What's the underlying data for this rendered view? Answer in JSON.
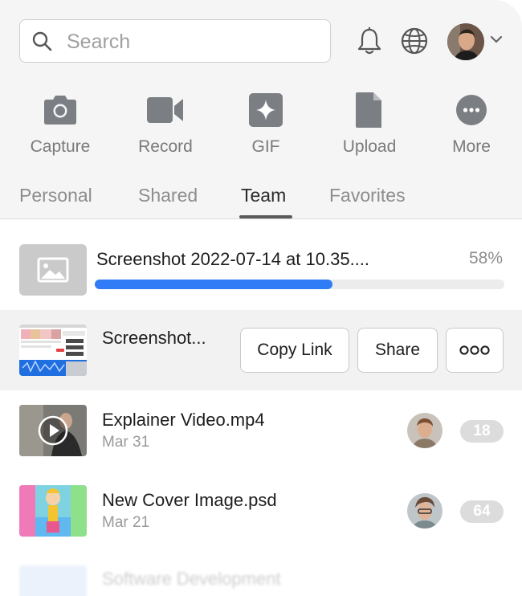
{
  "search": {
    "placeholder": "Search",
    "icon": "search-icon"
  },
  "header_icons": {
    "notifications": "bell-icon",
    "language": "globe-icon",
    "account_menu": "chevron-down-icon"
  },
  "actions": [
    {
      "label": "Capture",
      "icon": "camera-icon"
    },
    {
      "label": "Record",
      "icon": "video-camera-icon"
    },
    {
      "label": "GIF",
      "icon": "sparkle-icon"
    },
    {
      "label": "Upload",
      "icon": "document-icon"
    },
    {
      "label": "More",
      "icon": "more-icon"
    }
  ],
  "tabs": [
    {
      "label": "Personal",
      "active": false
    },
    {
      "label": "Shared",
      "active": false
    },
    {
      "label": "Team",
      "active": true
    },
    {
      "label": "Favorites",
      "active": false
    }
  ],
  "upload": {
    "name": "Screenshot 2022-07-14 at 10.35....",
    "progress_label": "58%",
    "progress": 0.58
  },
  "hovered_item": {
    "name": "Screenshot...",
    "buttons": {
      "copy_link": "Copy Link",
      "share": "Share",
      "more_icon": "more-horizontal-icon"
    }
  },
  "items": [
    {
      "name": "Explainer Video.mp4",
      "date": "Mar 31",
      "count": "18"
    },
    {
      "name": "New Cover Image.psd",
      "date": "Mar 21",
      "count": "64"
    },
    {
      "name": "Software Development"
    }
  ],
  "colors": {
    "accent": "#2f7cf6",
    "icon_gray": "#7b7e83",
    "panel_bg": "#f5f5f5"
  }
}
